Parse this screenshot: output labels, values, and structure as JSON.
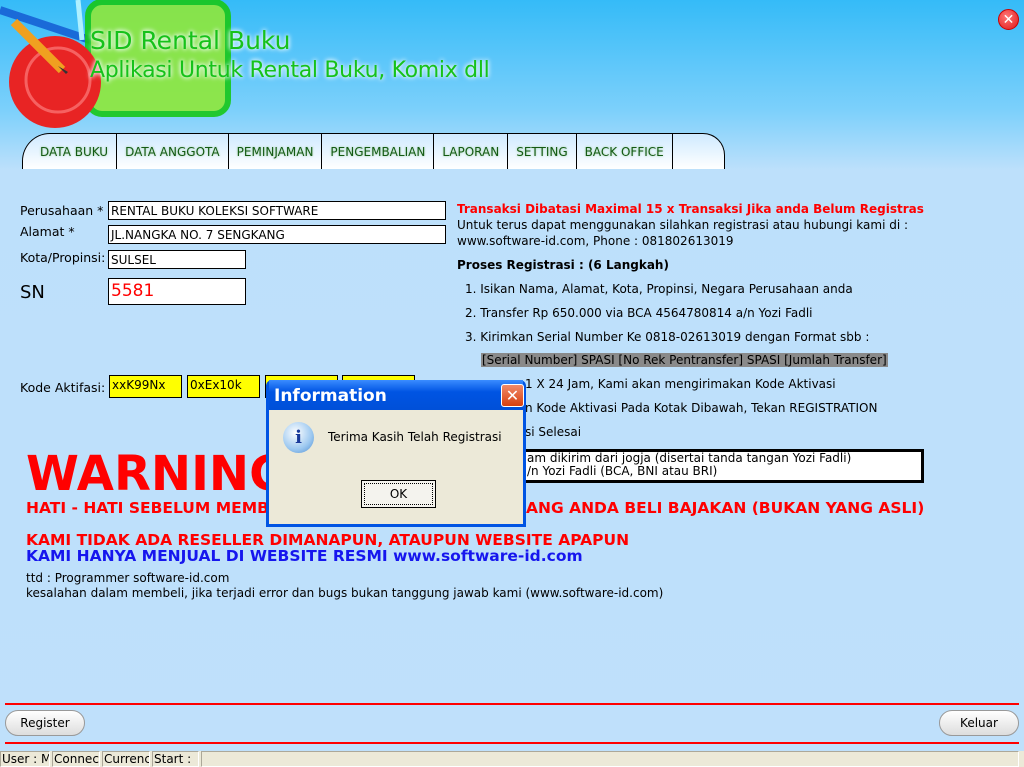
{
  "app": {
    "title": "SID Rental Buku",
    "subtitle": "Aplikasi Untuk Rental Buku, Komix dll",
    "close_icon": "close-circle-icon",
    "accent": "#16c21a"
  },
  "tabs": [
    "DATA BUKU",
    "DATA ANGGOTA",
    "PEMINJAMAN",
    "PENGEMBALIAN",
    "LAPORAN",
    "SETTING",
    "BACK OFFICE"
  ],
  "form": {
    "perusahaan_label": "Perusahaan *",
    "perusahaan_value": "RENTAL BUKU KOLEKSI SOFTWARE",
    "alamat_label": "Alamat *",
    "alamat_value": "JL.NANGKA NO. 7 SENGKANG",
    "kota_label": "Kota/Propinsi:",
    "kota_value": "SULSEL",
    "sn_label": "SN",
    "sn_value": "5581",
    "kode_label": "Kode Aktifasi:",
    "kode_values": [
      "xxK99Nx",
      "0xEx10k",
      "",
      ""
    ]
  },
  "info": {
    "limit": "Transaksi Dibatasi Maximal 15 x Transaksi Jika anda Belum Registras",
    "contact1": "Untuk terus dapat menggunakan silahkan registrasi atau hubungi kami di :",
    "contact2": "www.software-id.com, Phone : 081802613019",
    "steps_title": "Proses Registrasi : (6 Langkah)",
    "step1": "1. Isikan Nama, Alamat, Kota, Propinsi, Negara Perusahaan anda",
    "step2": "2. Transfer Rp 650.000 via BCA 4564780814 a/n Yozi Fadli",
    "step3": "3. Kirimkan Serial Number Ke 0818-02613019 dengan Format sbb :",
    "format": "[Serial Number] SPASI [No Rek Pentransfer] SPASI [Jumlah Transfer]",
    "step4_visible": "1 X 24 Jam, Kami akan mengirimakan Kode Aktivasi",
    "step5_visible": "n Kode Aktivasi Pada Kotak Dibawah, Tekan REGISTRATION",
    "step6_visible": "si Selesai",
    "box_line1": "am dikirim dari jogja (disertai tanda tangan Yozi Fadli)",
    "box_line2": "/n Yozi Fadli (BCA, BNI atau BRI)"
  },
  "warning": {
    "title": "WARNING",
    "line1_left": "HATI - HATI SEBELUM MEMBE",
    "line1_right": "ANG ANDA BELI BAJAKAN (BUKAN YANG ASLI)",
    "line2": "KAMI TIDAK ADA RESELLER DIMANAPUN, ATAUPUN WEBSITE APAPUN",
    "line3": "KAMI HANYA MENJUAL DI WEBSITE RESMI  www.software-id.com",
    "ttd": "ttd : Programmer software-id.com",
    "disclaimer": "kesalahan dalam membeli, jika terjadi error dan bugs bukan tanggung jawab kami (www.software-id.com)"
  },
  "buttons": {
    "register": "Register",
    "keluar": "Keluar"
  },
  "status": [
    "User  : M",
    "Connect",
    "Currenc",
    "Start  :",
    ""
  ],
  "dialog": {
    "title": "Information",
    "message": "Terima Kasih Telah Registrasi",
    "ok": "OK",
    "icon": "info-icon"
  }
}
